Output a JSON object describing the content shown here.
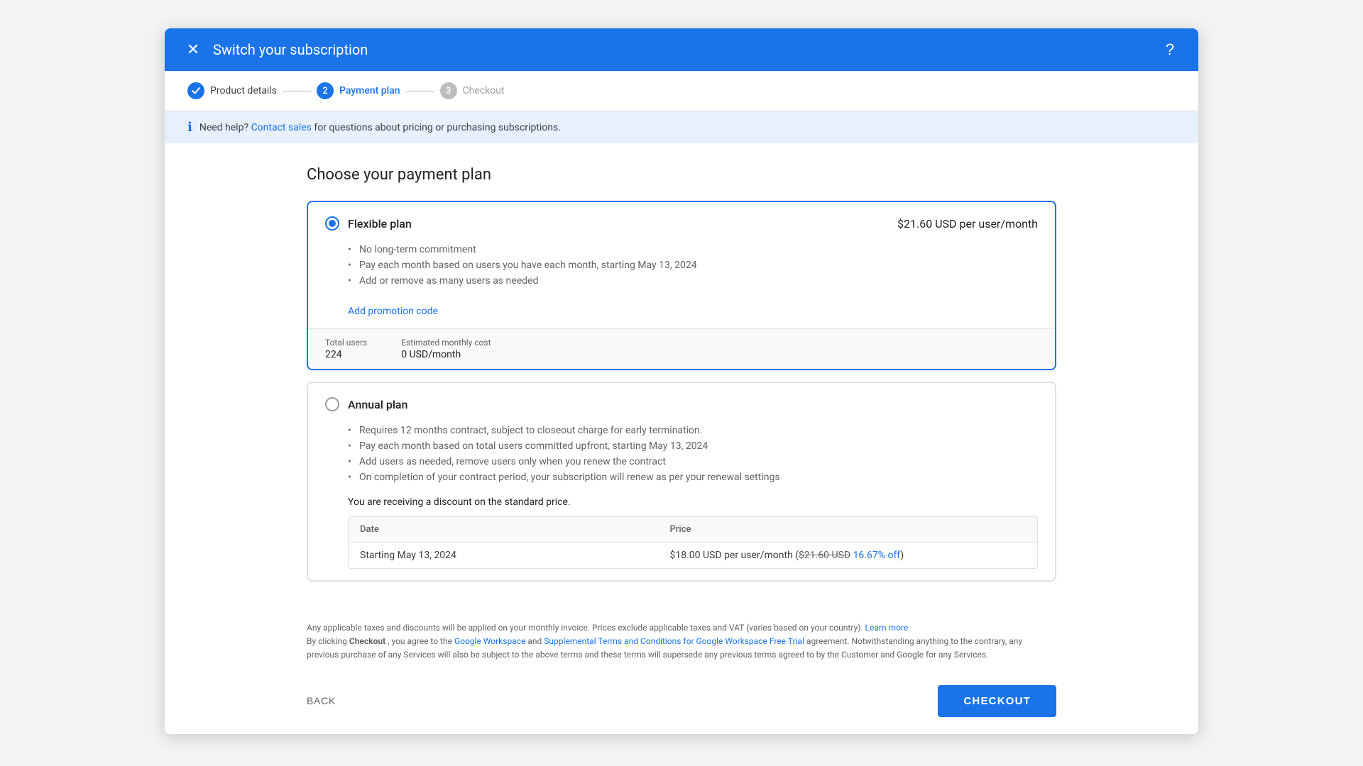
{
  "dialog": {
    "title": "Switch your subscription"
  },
  "stepper": {
    "steps": [
      {
        "id": "product-details",
        "number": "✓",
        "label": "Product details",
        "state": "done"
      },
      {
        "id": "payment-plan",
        "number": "2",
        "label": "Payment plan",
        "state": "active"
      },
      {
        "id": "checkout",
        "number": "3",
        "label": "Checkout",
        "state": "inactive"
      }
    ]
  },
  "info_bar": {
    "text_prefix": "Need help?",
    "link_text": "Contact sales",
    "text_suffix": " for questions about pricing or purchasing subscriptions."
  },
  "page_title": "Choose your payment plan",
  "flexible_plan": {
    "name": "Flexible plan",
    "price": "$21.60 USD per user/month",
    "bullets": [
      "No long-term commitment",
      "Pay each month based on users you have each month, starting May 13, 2024",
      "Add or remove as many users as needed"
    ],
    "promo_link": "Add promotion code",
    "totals": {
      "users_label": "Total users",
      "users_value": "224",
      "monthly_label": "Estimated monthly cost",
      "monthly_value": "0 USD/month"
    }
  },
  "annual_plan": {
    "name": "Annual plan",
    "bullets": [
      "Requires 12 months contract, subject to closeout charge for early termination.",
      "Pay each month based on total users committed upfront, starting May 13, 2024",
      "Add users as needed, remove users only when you renew the contract",
      "On completion of your contract period, your subscription will renew as per your renewal settings"
    ],
    "discount_note": "You are receiving a discount on the standard price.",
    "table": {
      "headers": [
        "Date",
        "Price"
      ],
      "rows": [
        {
          "date": "Starting May 13, 2024",
          "price_main": "$18.00 USD per user/month (",
          "price_strikethrough": "$21.60 USD",
          "price_discount": " 16.67% off",
          "price_close": ")"
        }
      ]
    }
  },
  "footer": {
    "tax_note": "Any applicable taxes and discounts will be applied on your monthly invoice. Prices exclude applicable taxes and VAT (varies based on your country).",
    "tax_link": "Learn more",
    "terms_prefix": "By clicking ",
    "terms_bold": "Checkout",
    "terms_mid": ", you agree to the ",
    "terms_link1": "Google Workspace",
    "terms_and": " and ",
    "terms_link2": "Supplemental Terms and Conditions for Google Workspace Free Trial",
    "terms_suffix": " agreement. Notwithstanding anything to the contrary, any previous purchase of any Services will also be subject to the above terms and these terms will supersede any previous terms agreed to by the Customer and Google for any Services.",
    "back_label": "BACK",
    "checkout_label": "CHECKOUT"
  },
  "icons": {
    "close": "✕",
    "help": "?",
    "info": "ℹ"
  }
}
